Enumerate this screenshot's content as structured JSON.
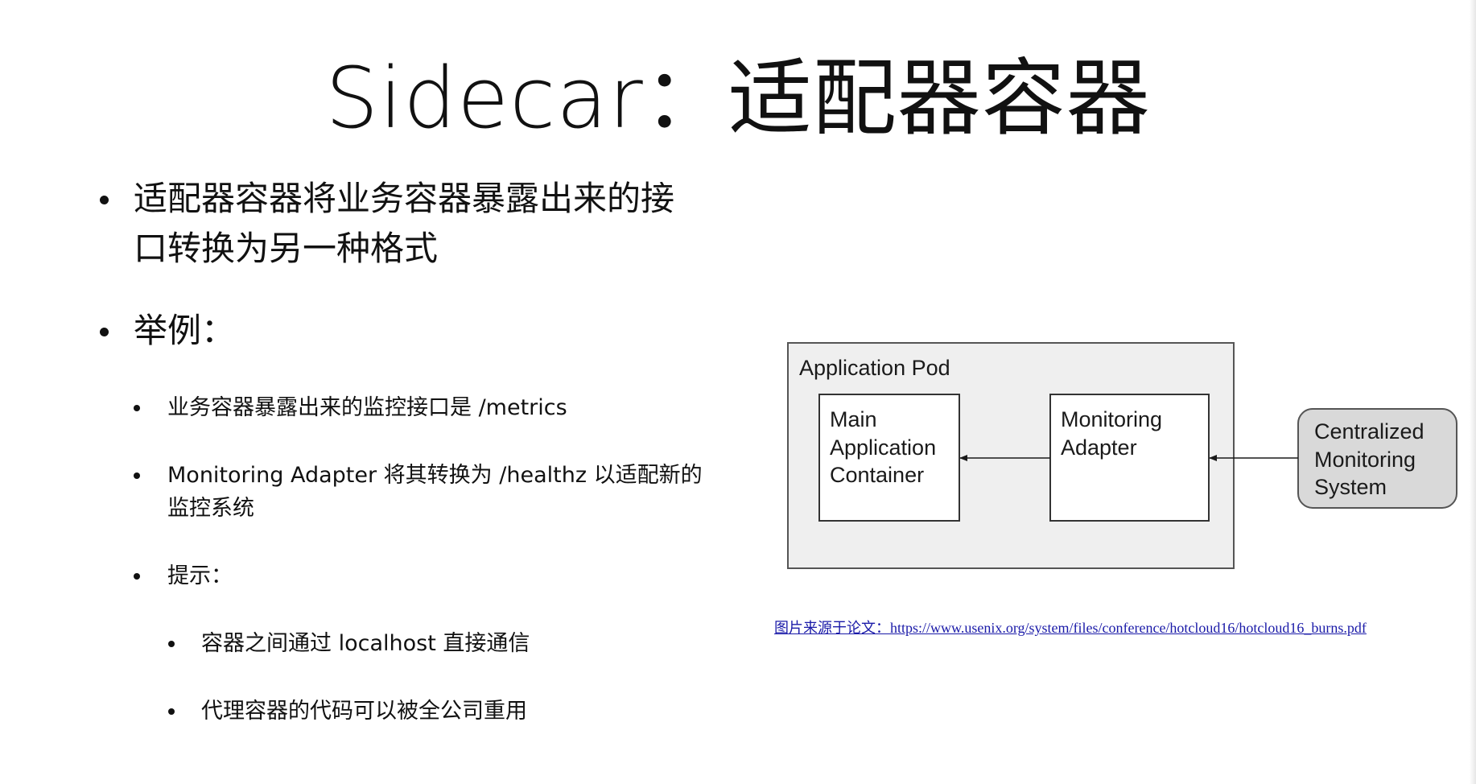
{
  "slide": {
    "title": "Sidecar：适配器容器",
    "bullets": {
      "b1_line1": "适配器容器将业务容器暴露出来的接",
      "b1_line2": "口转换为另一种格式",
      "b2": "举例：",
      "b2_1": "业务容器暴露出来的监控接口是 /metrics",
      "b2_2_line1": "Monitoring Adapter 将其转换为 /healthz 以适配新的",
      "b2_2_line2": "监控系统",
      "b2_3": "提示：",
      "b2_3_1": "容器之间通过 localhost 直接通信",
      "b2_3_2": "代理容器的代码可以被全公司重用"
    },
    "source_link": "图片来源于论文：https://www.usenix.org/system/files/conference/hotcloud16/hotcloud16_burns.pdf"
  },
  "diagram": {
    "pod_label": "Application Pod",
    "main_container": [
      "Main",
      "Application",
      "Container"
    ],
    "adapter": [
      "Monitoring",
      "Adapter"
    ],
    "central": [
      "Centralized",
      "Monitoring",
      "System"
    ],
    "colors": {
      "pod_fill": "#efefef",
      "pod_stroke": "#555555",
      "box_fill": "#ffffff",
      "central_fill": "#d9d9d9",
      "text": "#1a1a1a",
      "link": "#1a1aa8"
    }
  }
}
